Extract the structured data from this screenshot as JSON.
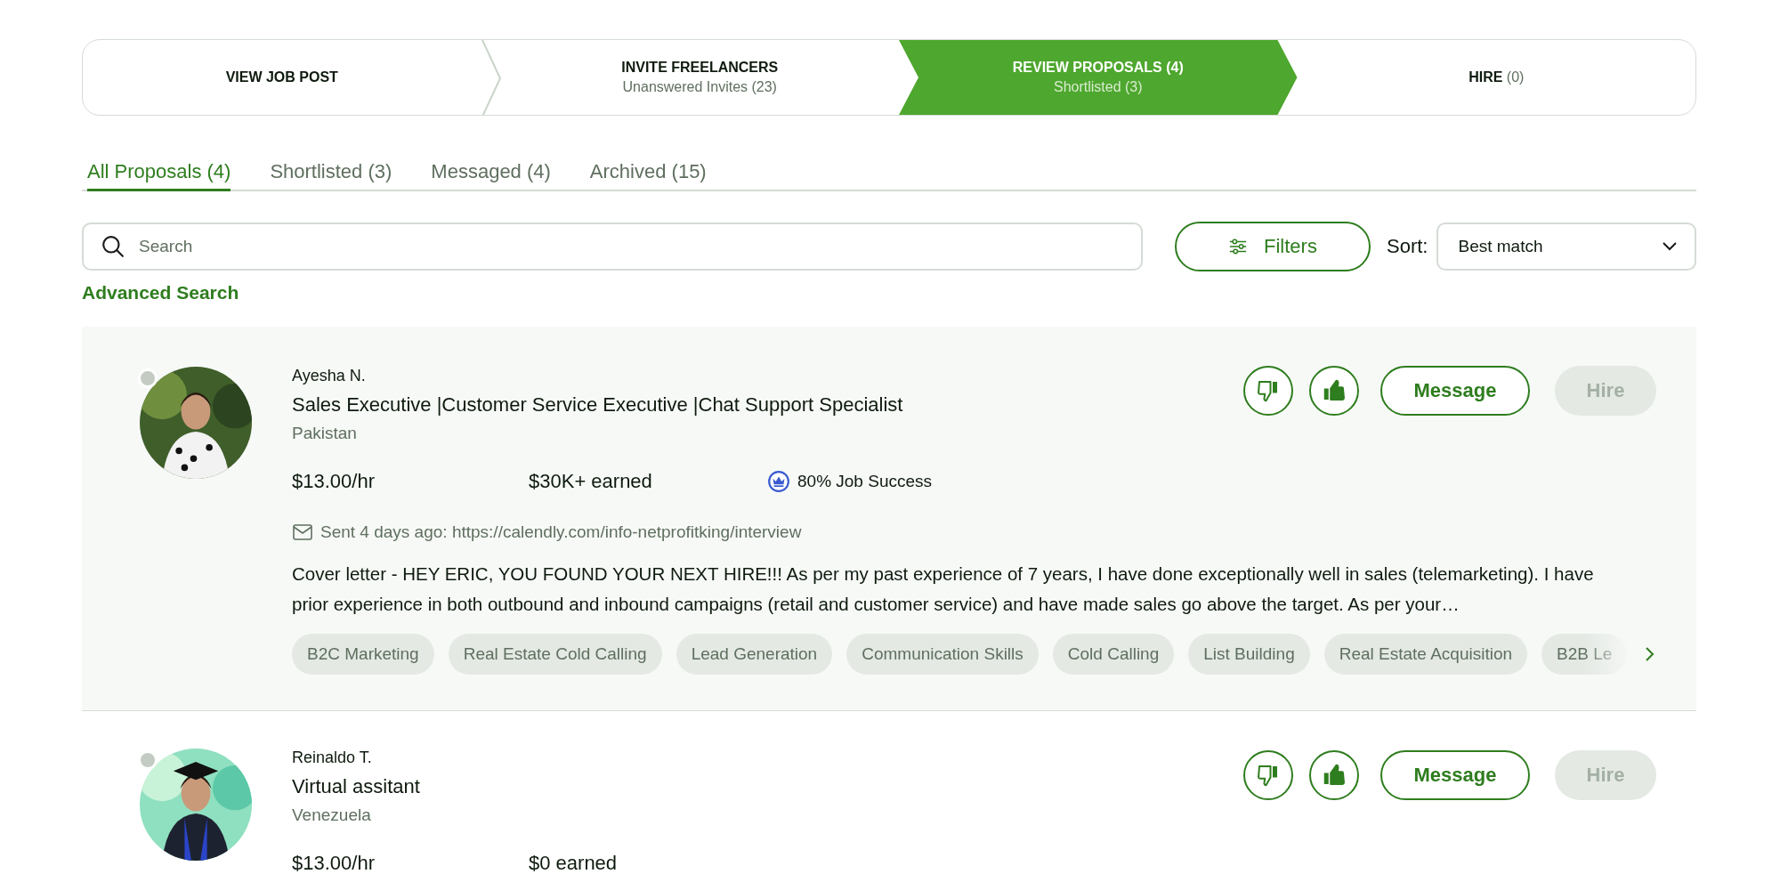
{
  "steps": [
    {
      "label": "VIEW JOB POST",
      "active": false
    },
    {
      "label": "INVITE FREELANCERS",
      "sub": "Unanswered Invites (23)",
      "active": false
    },
    {
      "label": "REVIEW PROPOSALS (4)",
      "sub": "Shortlisted (3)",
      "active": true
    },
    {
      "label": "HIRE",
      "count": "(0)",
      "active": false
    }
  ],
  "tabs": [
    {
      "label": "All Proposals (4)",
      "selected": true
    },
    {
      "label": "Shortlisted (3)",
      "selected": false
    },
    {
      "label": "Messaged (4)",
      "selected": false
    },
    {
      "label": "Archived (15)",
      "selected": false
    }
  ],
  "search": {
    "placeholder": "Search"
  },
  "filters_button": "Filters",
  "sort": {
    "label": "Sort:",
    "value": "Best match"
  },
  "advanced_search": "Advanced Search",
  "proposals": [
    {
      "selected": true,
      "online": false,
      "name": "Ayesha N.",
      "title": "Sales Executive |Customer Service Executive |Chat Support Specialist",
      "location": "Pakistan",
      "rate": "$13.00/hr",
      "earned": "$30K+ earned",
      "job_success": "80% Job Success",
      "message_note": "Sent 4 days ago: https://calendly.com/info-netprofitking/interview",
      "cover_letter": "Cover letter - HEY ERIC, YOU FOUND YOUR NEXT HIRE!!! As per my past experience of 7 years, I have done exceptionally well in sales (telemarketing). I have prior experience in both outbound and inbound campaigns (retail and customer service) and have made sales go above the target. As per your…",
      "skills": [
        "B2C Marketing",
        "Real Estate Cold Calling",
        "Lead Generation",
        "Communication Skills",
        "Cold Calling",
        "List Building",
        "Real Estate Acquisition",
        "B2B Le"
      ],
      "liked": true,
      "disliked": false,
      "message_button": "Message",
      "hire_button": "Hire",
      "hire_disabled": true
    },
    {
      "selected": false,
      "online": false,
      "name": "Reinaldo T.",
      "title": "Virtual assitant",
      "location": "Venezuela",
      "rate": "$13.00/hr",
      "earned": "$0 earned",
      "liked": true,
      "disliked": false,
      "message_button": "Message",
      "hire_button": "Hire",
      "hire_disabled": true
    }
  ]
}
